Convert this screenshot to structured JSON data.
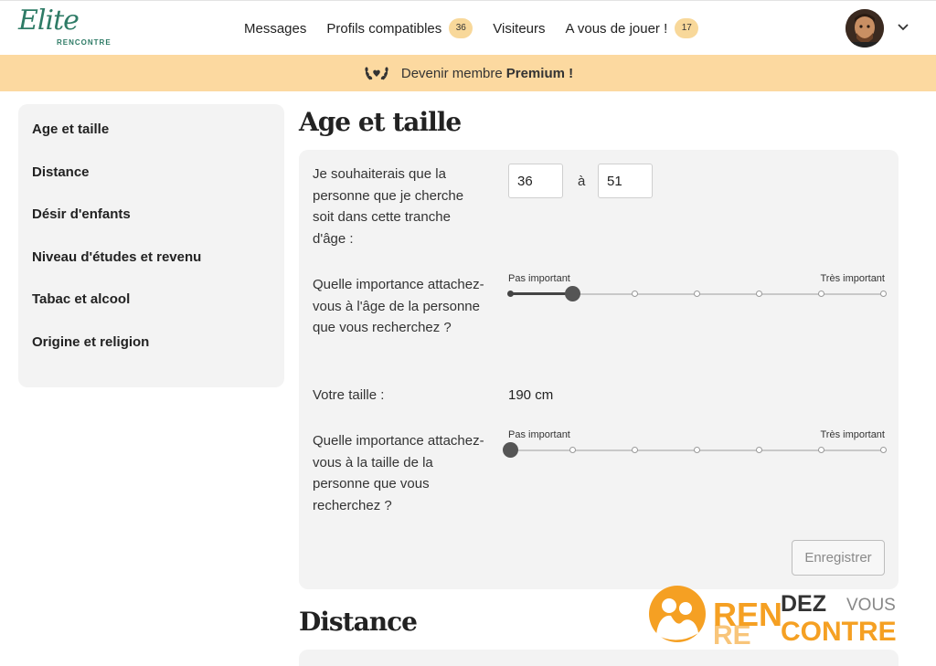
{
  "brand": {
    "script": "Elite",
    "sub": "RENCONTRE"
  },
  "nav": {
    "items": [
      {
        "label": "Messages"
      },
      {
        "label": "Profils compatibles",
        "badge": "36"
      },
      {
        "label": "Visiteurs"
      },
      {
        "label": "A vous de jouer !",
        "badge": "17"
      }
    ],
    "avatar_icon": "user-avatar",
    "menu_icon": "chevron-down-icon"
  },
  "premium": {
    "icon": "laurel-heart-icon",
    "text": "Devenir membre",
    "strong": "Premium !"
  },
  "sidebar": {
    "items": [
      {
        "label": "Age et taille"
      },
      {
        "label": "Distance"
      },
      {
        "label": "Désir d'enfants"
      },
      {
        "label": "Niveau d'études et revenu"
      },
      {
        "label": "Tabac et alcool"
      },
      {
        "label": "Origine et religion"
      }
    ]
  },
  "age_section": {
    "title": "Age et taille",
    "age_question": "Je souhaiterais que la personne que je cherche soit dans cette tranche d'âge :",
    "age_min": "36",
    "age_sep": "à",
    "age_max": "51",
    "age_importance": {
      "question": "Quelle importance attachez-vous à l'âge de la personne que vous recherchez ?",
      "left_label": "Pas important",
      "right_label": "Très important",
      "steps": 7,
      "value_step": 2
    },
    "height_label": "Votre taille :",
    "height_value": "190 cm",
    "height_importance": {
      "question": "Quelle importance attachez-vous à la taille de la personne que vous recherchez ?",
      "left_label": "Pas important",
      "right_label": "Très important",
      "steps": 7,
      "value_step": 1
    },
    "save_label": "Enregistrer"
  },
  "distance_section": {
    "title": "Distance"
  },
  "watermark": {
    "part1": "REN",
    "part2": "DEZ",
    "part3": "VOUS",
    "part4": "CONTRE",
    "part5": "RE"
  },
  "colors": {
    "accent": "#2e7b66",
    "premium_bg": "#fcd9a0",
    "badge": "#f8d89a",
    "panel": "#f3f3f3",
    "watermark": "#f5a023"
  }
}
